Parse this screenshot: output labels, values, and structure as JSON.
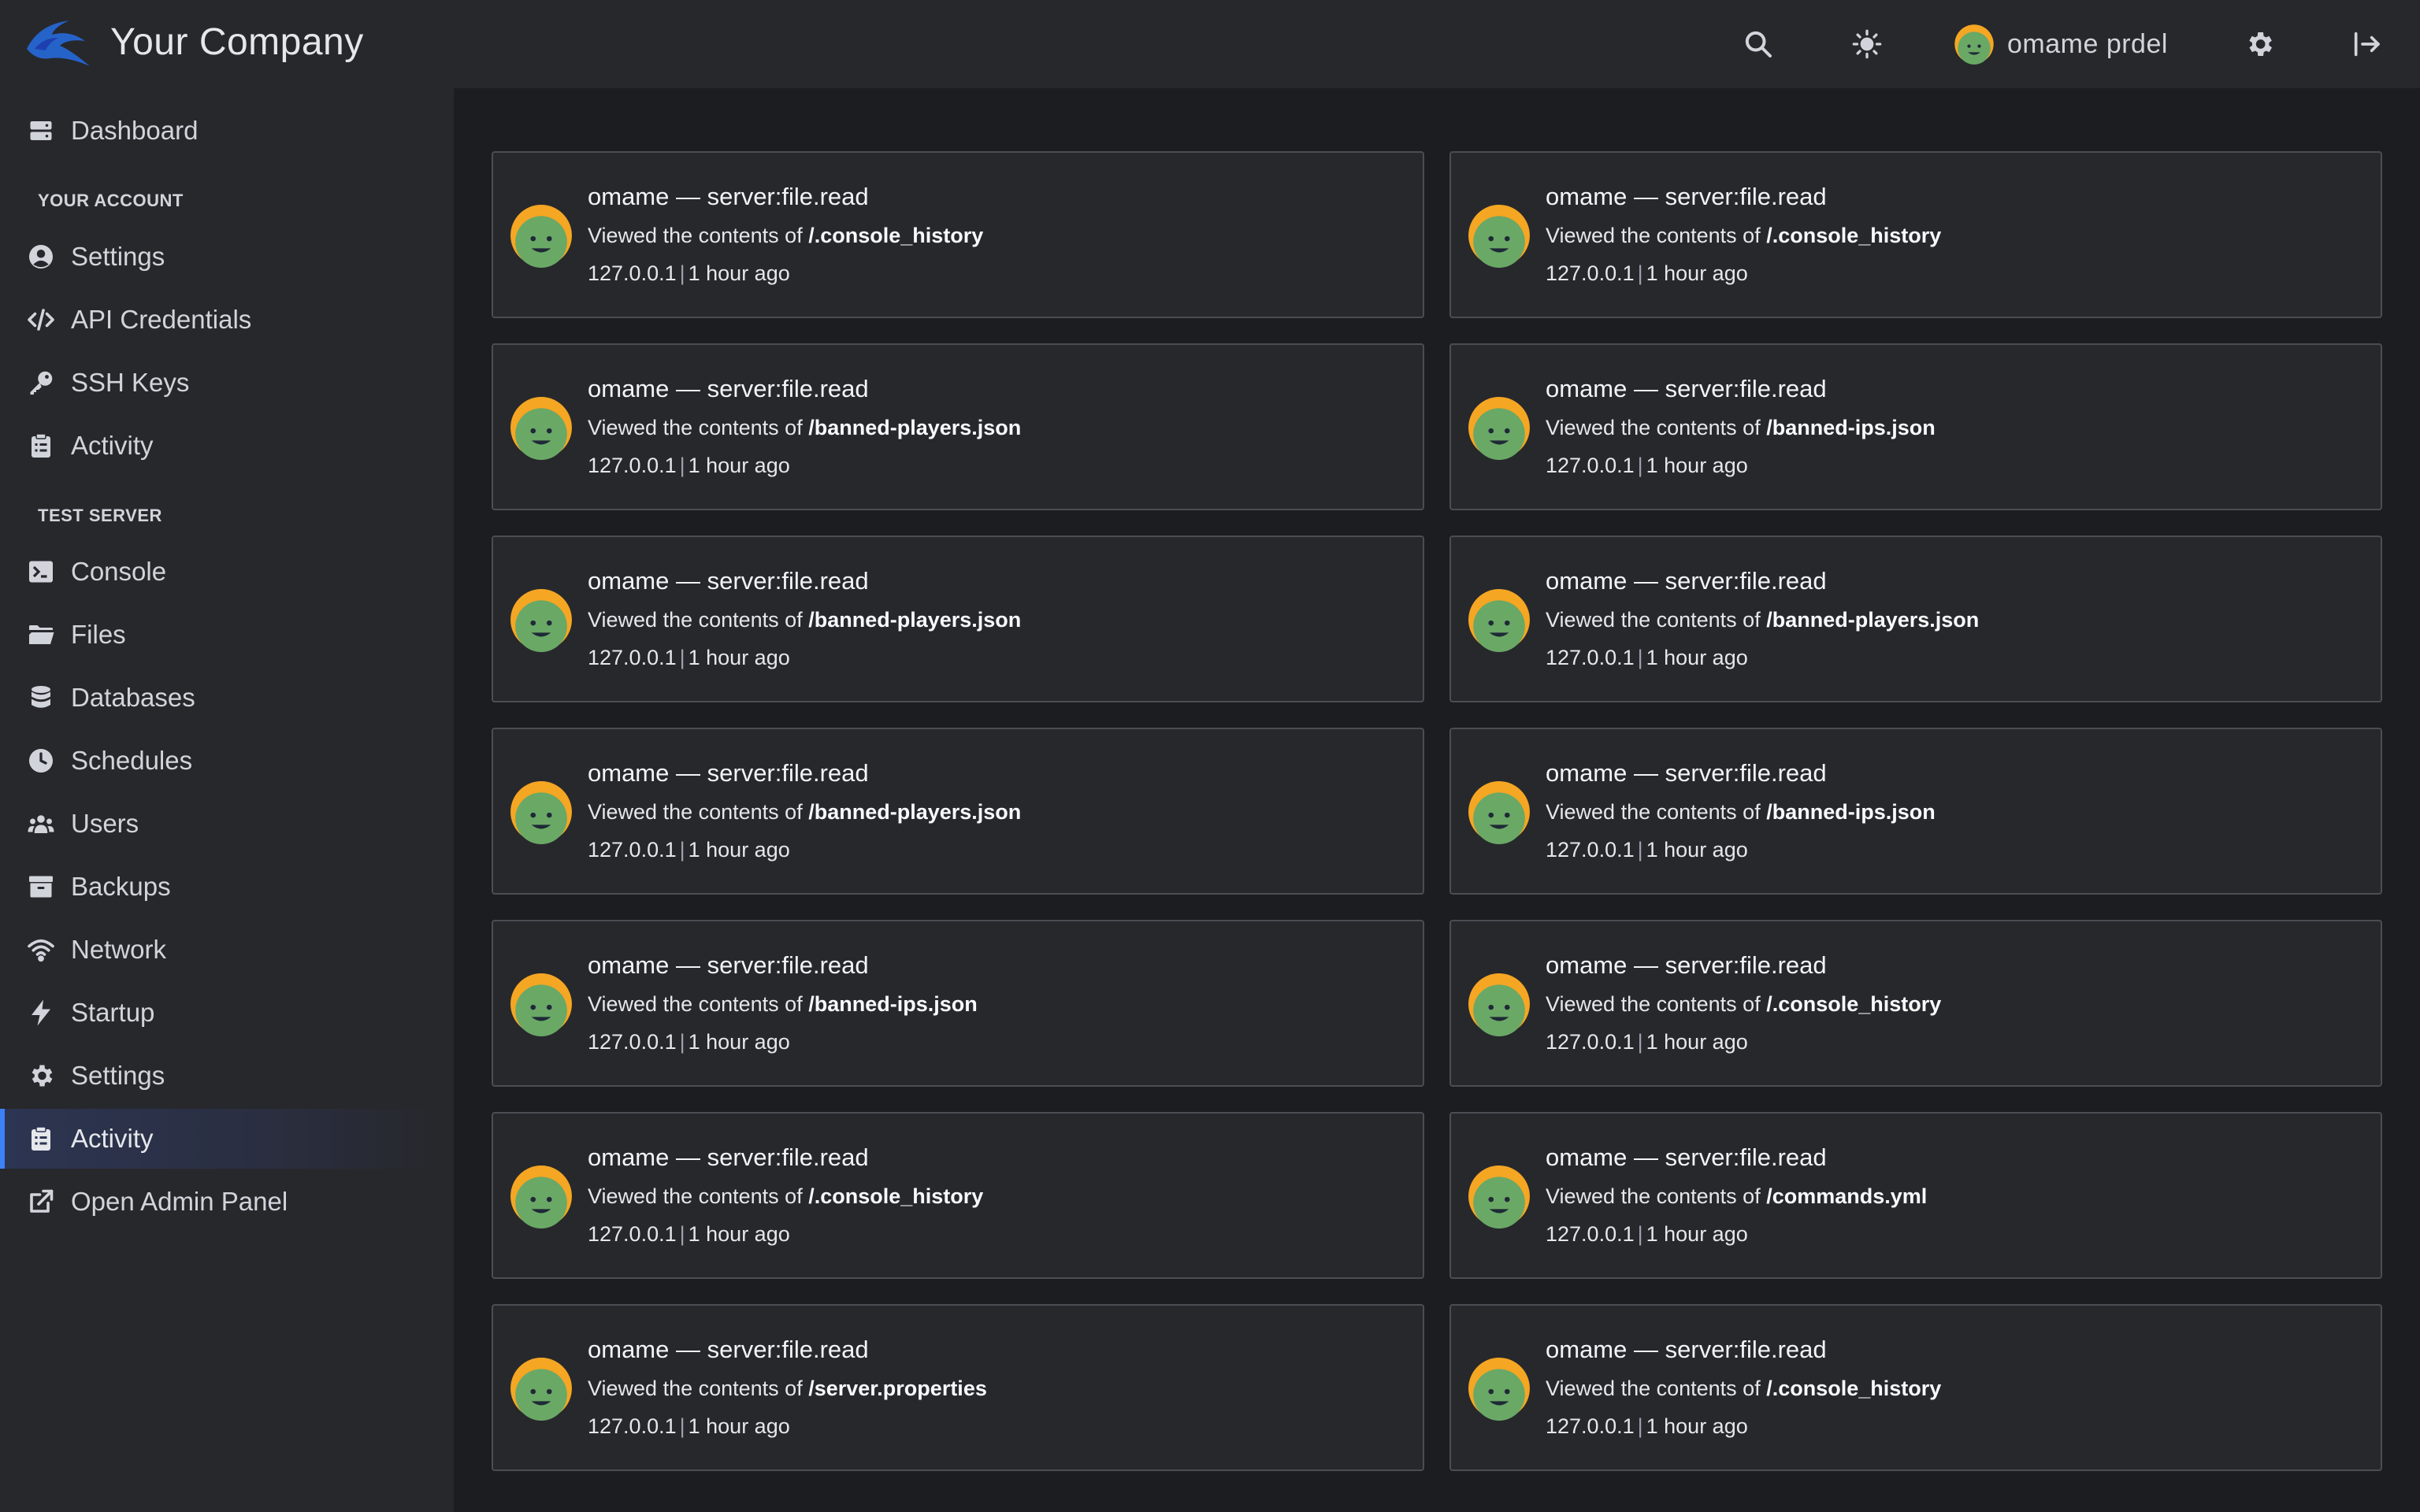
{
  "app": {
    "company": "Your Company"
  },
  "header": {
    "username": "omame prdel"
  },
  "sidebar": {
    "items_top": [
      {
        "label": "Dashboard",
        "icon": "dashboard-icon"
      }
    ],
    "account_title": "YOUR ACCOUNT",
    "account_items": [
      {
        "label": "Settings",
        "icon": "user-circle-icon"
      },
      {
        "label": "API Credentials",
        "icon": "code-icon"
      },
      {
        "label": "SSH Keys",
        "icon": "key-icon"
      },
      {
        "label": "Activity",
        "icon": "clipboard-icon"
      }
    ],
    "server_title": "TEST SERVER",
    "server_items": [
      {
        "label": "Console",
        "icon": "terminal-icon"
      },
      {
        "label": "Files",
        "icon": "folder-icon"
      },
      {
        "label": "Databases",
        "icon": "database-icon"
      },
      {
        "label": "Schedules",
        "icon": "clock-icon"
      },
      {
        "label": "Users",
        "icon": "users-icon"
      },
      {
        "label": "Backups",
        "icon": "archive-icon"
      },
      {
        "label": "Network",
        "icon": "wifi-icon"
      },
      {
        "label": "Startup",
        "icon": "bolt-icon"
      },
      {
        "label": "Settings",
        "icon": "gear-icon"
      },
      {
        "label": "Activity",
        "icon": "clipboard-icon"
      },
      {
        "label": "Open Admin Panel",
        "icon": "external-link-icon"
      }
    ],
    "active": "Activity"
  },
  "activity": {
    "entries": [
      {
        "user": "omame",
        "event": "server:file.read",
        "prefix": "Viewed the contents of",
        "file": "/.console_history",
        "ip": "127.0.0.1",
        "time": "1 hour ago"
      },
      {
        "user": "omame",
        "event": "server:file.read",
        "prefix": "Viewed the contents of",
        "file": "/.console_history",
        "ip": "127.0.0.1",
        "time": "1 hour ago"
      },
      {
        "user": "omame",
        "event": "server:file.read",
        "prefix": "Viewed the contents of",
        "file": "/banned-players.json",
        "ip": "127.0.0.1",
        "time": "1 hour ago"
      },
      {
        "user": "omame",
        "event": "server:file.read",
        "prefix": "Viewed the contents of",
        "file": "/banned-ips.json",
        "ip": "127.0.0.1",
        "time": "1 hour ago"
      },
      {
        "user": "omame",
        "event": "server:file.read",
        "prefix": "Viewed the contents of",
        "file": "/banned-players.json",
        "ip": "127.0.0.1",
        "time": "1 hour ago"
      },
      {
        "user": "omame",
        "event": "server:file.read",
        "prefix": "Viewed the contents of",
        "file": "/banned-players.json",
        "ip": "127.0.0.1",
        "time": "1 hour ago"
      },
      {
        "user": "omame",
        "event": "server:file.read",
        "prefix": "Viewed the contents of",
        "file": "/banned-players.json",
        "ip": "127.0.0.1",
        "time": "1 hour ago"
      },
      {
        "user": "omame",
        "event": "server:file.read",
        "prefix": "Viewed the contents of",
        "file": "/banned-ips.json",
        "ip": "127.0.0.1",
        "time": "1 hour ago"
      },
      {
        "user": "omame",
        "event": "server:file.read",
        "prefix": "Viewed the contents of",
        "file": "/banned-ips.json",
        "ip": "127.0.0.1",
        "time": "1 hour ago"
      },
      {
        "user": "omame",
        "event": "server:file.read",
        "prefix": "Viewed the contents of",
        "file": "/.console_history",
        "ip": "127.0.0.1",
        "time": "1 hour ago"
      },
      {
        "user": "omame",
        "event": "server:file.read",
        "prefix": "Viewed the contents of",
        "file": "/.console_history",
        "ip": "127.0.0.1",
        "time": "1 hour ago"
      },
      {
        "user": "omame",
        "event": "server:file.read",
        "prefix": "Viewed the contents of",
        "file": "/commands.yml",
        "ip": "127.0.0.1",
        "time": "1 hour ago"
      },
      {
        "user": "omame",
        "event": "server:file.read",
        "prefix": "Viewed the contents of",
        "file": "/server.properties",
        "ip": "127.0.0.1",
        "time": "1 hour ago"
      },
      {
        "user": "omame",
        "event": "server:file.read",
        "prefix": "Viewed the contents of",
        "file": "/.console_history",
        "ip": "127.0.0.1",
        "time": "1 hour ago"
      }
    ],
    "dash": "—",
    "pipe": "|"
  },
  "colors": {
    "accent": "#3b82f6",
    "background": "#1c1d21",
    "panel": "#27282c",
    "avatar_green": "#6aa866",
    "avatar_orange": "#f5a623"
  }
}
